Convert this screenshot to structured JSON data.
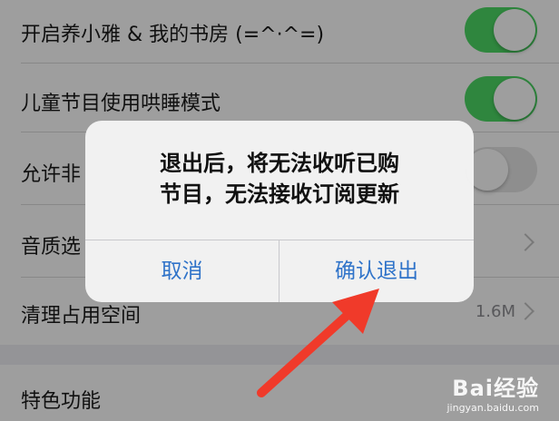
{
  "settings": {
    "rows": [
      {
        "label": "开启养小雅 & 我的书房 (=^·^=)",
        "control": "toggle",
        "state": "on"
      },
      {
        "label": "儿童节目使用哄睡模式",
        "control": "toggle",
        "state": "on"
      },
      {
        "label": "允许非",
        "control": "toggle",
        "state": "off"
      },
      {
        "label": "音质选",
        "control": "chevron"
      },
      {
        "label": "清理占用空间",
        "control": "value-chevron",
        "value": "1.6M"
      }
    ],
    "section2": {
      "label": "特色功能"
    }
  },
  "dialog": {
    "message": "退出后，将无法收听已购节目，无法接收订阅更新",
    "cancel_label": "取消",
    "confirm_label": "确认退出"
  },
  "annotation": {
    "arrow_color": "#f03a2a"
  },
  "colors": {
    "toggle_on": "#4cd964",
    "button_text": "#2f73c9"
  },
  "watermark": {
    "logo": "Bai经验",
    "url": "jingyan.baidu.com"
  }
}
